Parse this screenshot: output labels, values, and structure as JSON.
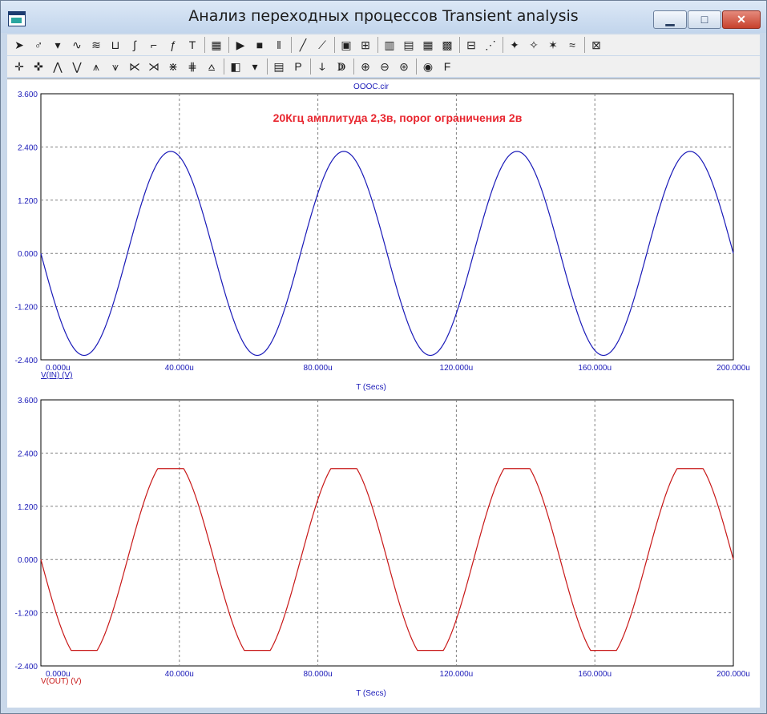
{
  "window": {
    "title": "Анализ переходных процессов Transient analysis"
  },
  "window_buttons": {
    "minimize": "▁",
    "maximize": "□",
    "close": "✕"
  },
  "colors": {
    "series_in": "#1a1ab8",
    "series_out": "#c81818",
    "axis_text": "#1a1ab8",
    "annotation": "#e8262f",
    "grid": "#808080"
  },
  "toolbar1": [
    {
      "icon": "select-arrow-icon",
      "glyph": "➤"
    },
    {
      "icon": "component-icon",
      "glyph": "♂"
    },
    {
      "icon": "dropdown-icon",
      "glyph": "▾"
    },
    {
      "icon": "curve-1-icon",
      "glyph": "∿"
    },
    {
      "icon": "curve-2-icon",
      "glyph": "≋"
    },
    {
      "icon": "curve-3-icon",
      "glyph": "⊔"
    },
    {
      "icon": "curve-4-icon",
      "glyph": "∫"
    },
    {
      "icon": "curve-5-icon",
      "glyph": "⌐"
    },
    {
      "icon": "curve-6-icon",
      "glyph": "ƒ"
    },
    {
      "icon": "text-icon",
      "glyph": "T"
    },
    {
      "icon": "properties-icon",
      "glyph": "▦"
    },
    {
      "icon": "run-icon",
      "glyph": "▶"
    },
    {
      "icon": "stop-icon",
      "glyph": "■"
    },
    {
      "icon": "pause-icon",
      "glyph": "‖"
    },
    {
      "icon": "line-icon",
      "glyph": "╱"
    },
    {
      "icon": "line-points-icon",
      "glyph": "⟋"
    },
    {
      "icon": "zoom-box-icon",
      "glyph": "▣"
    },
    {
      "icon": "grid-icon",
      "glyph": "⊞"
    },
    {
      "icon": "grid-v-icon",
      "glyph": "▥"
    },
    {
      "icon": "grid-h-icon",
      "glyph": "▤"
    },
    {
      "icon": "grid-minor-icon",
      "glyph": "▦"
    },
    {
      "icon": "grid-dots-icon",
      "glyph": "▩"
    },
    {
      "icon": "baseline-icon",
      "glyph": "⊟"
    },
    {
      "icon": "tracker-icon",
      "glyph": "⋰"
    },
    {
      "icon": "marker-1-icon",
      "glyph": "✦"
    },
    {
      "icon": "marker-2-icon",
      "glyph": "✧"
    },
    {
      "icon": "marker-3-icon",
      "glyph": "✶"
    },
    {
      "icon": "marker-4-icon",
      "glyph": "≈"
    },
    {
      "icon": "delete-icon",
      "glyph": "⊠"
    }
  ],
  "toolbar2": [
    {
      "icon": "cursor-cross-icon",
      "glyph": "✛"
    },
    {
      "icon": "cursor-move-icon",
      "glyph": "✜"
    },
    {
      "icon": "peak-icon",
      "glyph": "⋀"
    },
    {
      "icon": "valley-icon",
      "glyph": "⋁"
    },
    {
      "icon": "high-icon",
      "glyph": "⩚"
    },
    {
      "icon": "low-icon",
      "glyph": "⩛"
    },
    {
      "icon": "inflect-icon",
      "glyph": "⋉"
    },
    {
      "icon": "slope-icon",
      "glyph": "⋊"
    },
    {
      "icon": "global-high-icon",
      "glyph": "⋇"
    },
    {
      "icon": "global-low-icon",
      "glyph": "⋕"
    },
    {
      "icon": "top-icon",
      "glyph": "⩟"
    },
    {
      "icon": "folder-icon",
      "glyph": "◧"
    },
    {
      "icon": "dropdown2-icon",
      "glyph": "▾"
    },
    {
      "icon": "table-icon",
      "glyph": "▤"
    },
    {
      "icon": "data-points-icon",
      "glyph": "P"
    },
    {
      "icon": "tag-1-icon",
      "glyph": "ↆ"
    },
    {
      "icon": "tag-2-icon",
      "glyph": "ↇ"
    },
    {
      "icon": "zoom-in-icon",
      "glyph": "⊕"
    },
    {
      "icon": "zoom-out-icon",
      "glyph": "⊖"
    },
    {
      "icon": "zoom-fit-icon",
      "glyph": "⊛"
    },
    {
      "icon": "palette-icon",
      "glyph": "◉"
    },
    {
      "icon": "font-icon",
      "glyph": "F"
    }
  ],
  "chart_data": [
    {
      "type": "line",
      "title": "OOOC.cir",
      "annotation": "20Кгц амплитуда 2,3в, порог ограничения 2в",
      "xlabel": "T (Secs)",
      "ylabel": "",
      "xlim": [
        0,
        200
      ],
      "ylim": [
        -2.4,
        3.6
      ],
      "x_tick_labels": [
        "0.000u",
        "40.000u",
        "80.000u",
        "120.000u",
        "160.000u",
        "200.000u"
      ],
      "y_tick_labels": [
        "3.600",
        "2.400",
        "1.200",
        "0.000",
        "-1.200",
        "-2.400"
      ],
      "grid": true,
      "legend": "bottom-left",
      "series": [
        {
          "name": "V(IN) (V)",
          "color": "#1a1ab8",
          "amplitude": 2.3,
          "frequency_khz": 20,
          "clip": null,
          "x": [
            0,
            12.5,
            25,
            37.5,
            50,
            62.5,
            75,
            87.5,
            100,
            112.5,
            125,
            137.5,
            150,
            162.5,
            175,
            187.5,
            200
          ],
          "values": [
            0,
            -2.3,
            0,
            2.3,
            0,
            -2.3,
            0,
            2.3,
            0,
            -2.3,
            0,
            2.3,
            0,
            -2.3,
            0,
            2.3,
            0
          ]
        }
      ]
    },
    {
      "type": "line",
      "title": "",
      "xlabel": "T (Secs)",
      "ylabel": "",
      "xlim": [
        0,
        200
      ],
      "ylim": [
        -2.4,
        3.6
      ],
      "x_tick_labels": [
        "0.000u",
        "40.000u",
        "80.000u",
        "120.000u",
        "160.000u",
        "200.000u"
      ],
      "y_tick_labels": [
        "3.600",
        "2.400",
        "1.200",
        "0.000",
        "-1.200",
        "-2.400"
      ],
      "grid": true,
      "legend": "bottom-left",
      "series": [
        {
          "name": "V(OUT) (V)",
          "color": "#c81818",
          "amplitude": 2.3,
          "frequency_khz": 20,
          "clip": 2.05,
          "x": [
            0,
            9,
            16,
            25,
            34,
            41,
            50,
            59,
            66,
            75,
            84,
            91,
            100,
            109,
            116,
            125,
            134,
            141,
            150,
            159,
            166,
            175,
            184,
            191,
            200
          ],
          "values": [
            0,
            -2.05,
            -2.05,
            0,
            2.05,
            2.05,
            0,
            -2.05,
            -2.05,
            0,
            2.05,
            2.05,
            0,
            -2.05,
            -2.05,
            0,
            2.05,
            2.05,
            0,
            -2.05,
            -2.05,
            0,
            2.05,
            2.05,
            0.2
          ]
        }
      ]
    }
  ]
}
